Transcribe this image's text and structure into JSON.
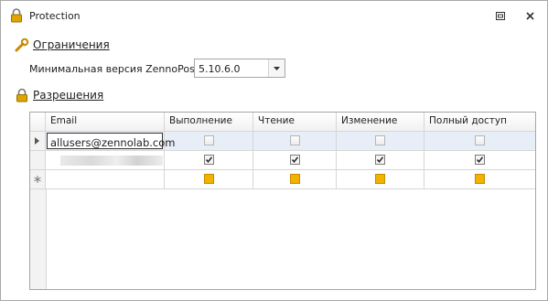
{
  "window": {
    "title": "Protection",
    "icon": "lock-icon"
  },
  "title_buttons": {
    "restore_icon": "restore-icon",
    "close_icon": "close-icon"
  },
  "restrictions": {
    "heading": "Ограничения",
    "icon": "wrench-icon",
    "version_label": "Минимальная версия ZennoPoster:",
    "version_value": "5.10.6.0"
  },
  "permissions": {
    "heading": "Разрешения",
    "icon": "lock-icon",
    "columns": [
      "Email",
      "Выполнение",
      "Чтение",
      "Изменение",
      "Полный доступ"
    ],
    "rows": [
      {
        "marker": "current-row",
        "email": "allusers@zennolab.com",
        "checks": [
          false,
          false,
          false,
          false
        ],
        "state": "editing"
      },
      {
        "marker": "",
        "email": "",
        "email_blurred": true,
        "checks": [
          true,
          true,
          true,
          true
        ],
        "state": "normal"
      },
      {
        "marker": "new-row",
        "email": "",
        "checks": [
          null,
          null,
          null,
          null
        ],
        "state": "new"
      }
    ]
  },
  "colors": {
    "selected_row": "#e8eef8",
    "new_check": "#f2b200"
  }
}
